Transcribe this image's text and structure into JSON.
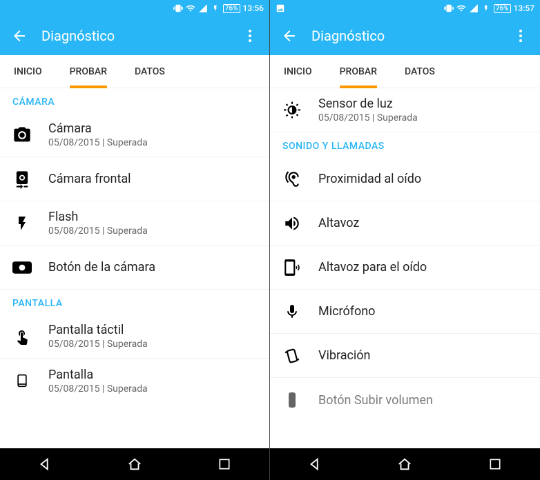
{
  "status": {
    "battery": "76%",
    "time_left": "13:56",
    "time_right": "13:57"
  },
  "appbar": {
    "title": "Diagnóstico"
  },
  "tabs": {
    "inicio": "INICIO",
    "probar": "PROBAR",
    "datos": "DATOS"
  },
  "left": {
    "sections": {
      "camera": {
        "header": "CÁMARA",
        "items": {
          "camera": {
            "title": "Cámara",
            "sub": "05/08/2015 | Superada"
          },
          "front_camera": {
            "title": "Cámara frontal"
          },
          "flash": {
            "title": "Flash",
            "sub": "05/08/2015 | Superada"
          },
          "camera_button": {
            "title": "Botón de la cámara"
          }
        }
      },
      "screen": {
        "header": "PANTALLA",
        "items": {
          "touch": {
            "title": "Pantalla táctil",
            "sub": "05/08/2015 | Superada"
          },
          "display": {
            "title": "Pantalla",
            "sub": "05/08/2015 | Superada"
          }
        }
      }
    }
  },
  "right": {
    "light_sensor": {
      "title": "Sensor de luz",
      "sub": "05/08/2015 | Superada"
    },
    "section_header": "SONIDO Y LLAMADAS",
    "items": {
      "proximity": {
        "title": "Proximidad al oído"
      },
      "speaker": {
        "title": "Altavoz"
      },
      "earpiece": {
        "title": "Altavoz para el oído"
      },
      "microphone": {
        "title": "Micrófono"
      },
      "vibration": {
        "title": "Vibración"
      },
      "volume_up": {
        "title": "Botón Subir volumen"
      }
    }
  }
}
